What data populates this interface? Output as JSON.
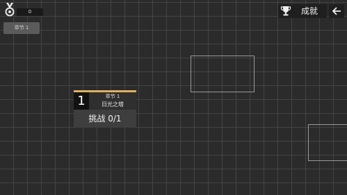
{
  "header": {
    "medal_count": "0",
    "chapter_chip": "章节 1",
    "achievements_label": "成就",
    "icons": {
      "medal": "medal-icon",
      "trophy": "trophy-icon",
      "back": "back-arrow-icon"
    }
  },
  "level_card": {
    "number": "1",
    "chapter": "章节 1",
    "name": "日光之塔",
    "challenge": "挑战 0/1"
  },
  "colors": {
    "background": "#2b2b2b",
    "grid": "#444444",
    "accent": "#e0b060"
  }
}
